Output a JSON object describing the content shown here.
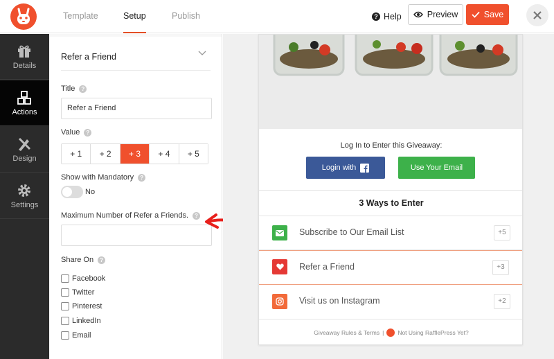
{
  "topbar": {
    "tabs": [
      {
        "label": "Template"
      },
      {
        "label": "Setup"
      },
      {
        "label": "Publish"
      }
    ],
    "help_label": "Help",
    "preview_label": "Preview",
    "save_label": "Save",
    "accent": "#f0502d"
  },
  "sidebar": {
    "items": [
      {
        "label": "Details",
        "icon": "gift-icon"
      },
      {
        "label": "Actions",
        "icon": "cubes-icon"
      },
      {
        "label": "Design",
        "icon": "design-tools-icon"
      },
      {
        "label": "Settings",
        "icon": "gear-icon"
      }
    ],
    "active": "Actions"
  },
  "panel": {
    "section_title": "Refer a Friend",
    "title_label": "Title",
    "title_value": "Refer a Friend",
    "value_label": "Value",
    "value_options": [
      "+ 1",
      "+ 2",
      "+ 3",
      "+ 4",
      "+ 5"
    ],
    "value_selected": "+ 3",
    "mandatory_label": "Show with Mandatory",
    "mandatory_state": "No",
    "max_label": "Maximum Number of Refer a Friends.",
    "max_value": "",
    "share_label": "Share On",
    "share_options": [
      "Facebook",
      "Twitter",
      "Pinterest",
      "LinkedIn",
      "Email"
    ]
  },
  "preview": {
    "login_text": "Log In to Enter this Giveaway:",
    "fb_button": "Login with",
    "email_button": "Use Your Email",
    "ways_title": "3 Ways to Enter",
    "entries": [
      {
        "label": "Subscribe to Our Email List",
        "points": "+5",
        "icon": "envelope-icon",
        "color": "#3db14a"
      },
      {
        "label": "Refer a Friend",
        "points": "+3",
        "icon": "heart-icon",
        "color": "#e53935"
      },
      {
        "label": "Visit us on Instagram",
        "points": "+2",
        "icon": "instagram-icon",
        "color": "#f26a3a"
      }
    ],
    "footer_rules": "Giveaway Rules & Terms",
    "footer_sep": "|",
    "footer_promo": "Not Using RafflePress Yet?"
  }
}
